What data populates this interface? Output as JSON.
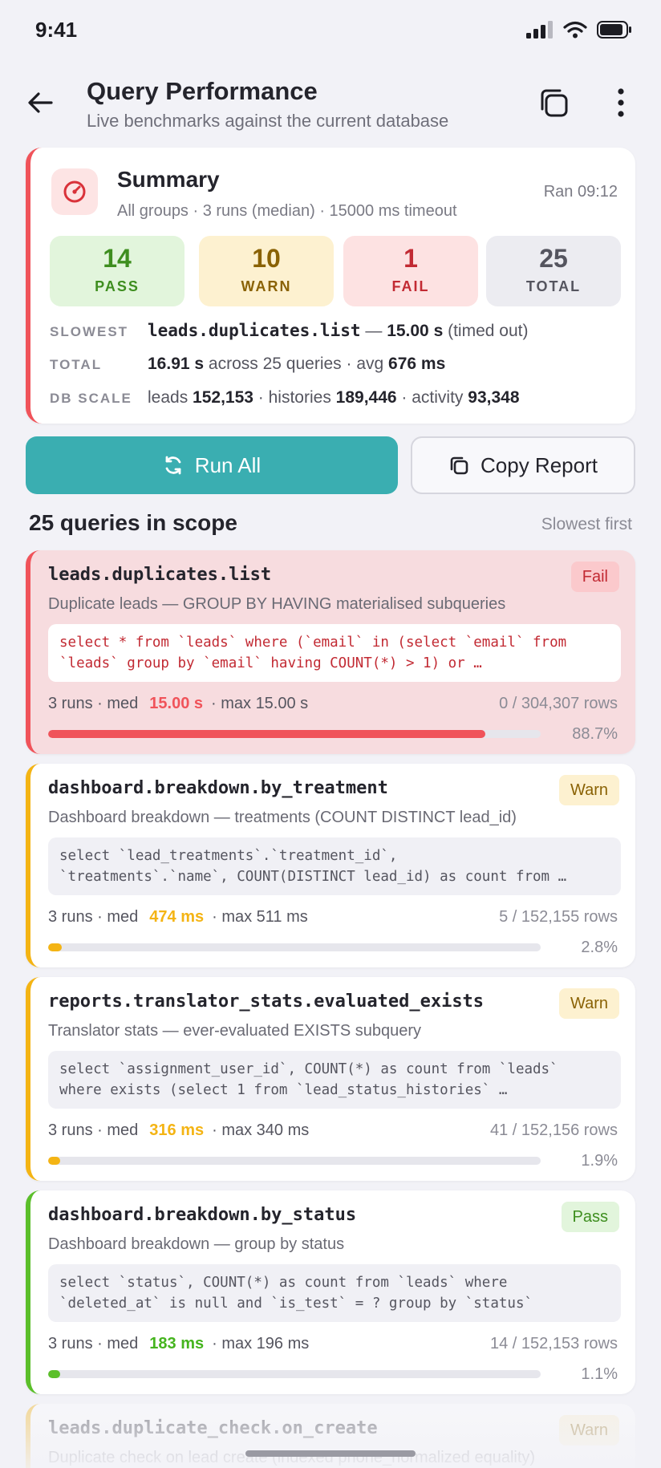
{
  "status_bar": {
    "time": "9:41"
  },
  "header": {
    "title": "Query Performance",
    "subtitle": "Live benchmarks against the current database"
  },
  "summary": {
    "title": "Summary",
    "subtitle": "All groups · 3 runs (median) · 15000 ms timeout",
    "ran": "Ran 09:12",
    "stats": {
      "pass": {
        "value": "14",
        "label": "PASS"
      },
      "warn": {
        "value": "10",
        "label": "WARN"
      },
      "fail": {
        "value": "1",
        "label": "FAIL"
      },
      "total": {
        "value": "25",
        "label": "TOTAL"
      }
    },
    "slowest": {
      "key": "SLOWEST",
      "query": "leads.duplicates.list",
      "sep": " — ",
      "time": "15.00 s",
      "note": " (timed out)"
    },
    "total": {
      "key": "TOTAL",
      "time": "16.91 s",
      "mid": " across 25 queries · avg ",
      "avg": "676 ms"
    },
    "db_scale": {
      "key": "DB SCALE",
      "l1": "leads ",
      "v1": "152,153",
      "l2": " · histories ",
      "v2": "189,446",
      "l3": " · activity ",
      "v3": "93,348"
    }
  },
  "actions": {
    "run_all": "Run All",
    "copy_report": "Copy Report"
  },
  "scope": {
    "title": "25 queries in scope",
    "sort": "Slowest first"
  },
  "stats_prefix": "3 runs · med",
  "max_prefix": "· max",
  "queries": [
    {
      "name": "leads.duplicates.list",
      "status": "Fail",
      "desc": "Duplicate leads — GROUP BY HAVING materialised subqueries",
      "sql1": "select * from `leads` where (`email` in (select `email` from",
      "sql2": "`leads` group by `email` having COUNT(*) > 1) or …",
      "med": "15.00 s",
      "max": "15.00 s",
      "rows": "0 / 304,307 rows",
      "pct": "88.7%",
      "fraction": 0.887
    },
    {
      "name": "dashboard.breakdown.by_treatment",
      "status": "Warn",
      "desc": "Dashboard breakdown — treatments (COUNT DISTINCT lead_id)",
      "sql1": "select `lead_treatments`.`treatment_id`,",
      "sql2": "`treatments`.`name`, COUNT(DISTINCT lead_id) as count from …",
      "med": "474 ms",
      "max": "511 ms",
      "rows": "5 / 152,155 rows",
      "pct": "2.8%",
      "fraction": 0.028
    },
    {
      "name": "reports.translator_stats.evaluated_exists",
      "status": "Warn",
      "desc": "Translator stats — ever-evaluated EXISTS subquery",
      "sql1": "select `assignment_user_id`, COUNT(*) as count from `leads`",
      "sql2": "where exists (select 1 from `lead_status_histories` …",
      "med": "316 ms",
      "max": "340 ms",
      "rows": "41 / 152,156 rows",
      "pct": "1.9%",
      "fraction": 0.019
    },
    {
      "name": "dashboard.breakdown.by_status",
      "status": "Pass",
      "desc": "Dashboard breakdown — group by status",
      "sql1": "select `status`, COUNT(*) as count from `leads` where",
      "sql2": "`deleted_at` is null and `is_test` = ? group by `status`",
      "med": "183 ms",
      "max": "196 ms",
      "rows": "14 / 152,153 rows",
      "pct": "1.1%",
      "fraction": 0.011
    },
    {
      "name": "leads.duplicate_check.on_create",
      "status": "Warn",
      "desc": "Duplicate check on lead create (indexed phone_normalized equality)"
    }
  ],
  "colors": {
    "accent": "#3aaeb1",
    "fail": "#f0535a",
    "warn": "#f4b414",
    "pass": "#5bbf2a"
  },
  "icons": {
    "back": "arrow-left-icon",
    "copy": "copy-icon",
    "more": "more-vertical-icon",
    "summary": "gauge-icon",
    "run": "refresh-icon",
    "report": "copy-icon",
    "signal": "signal-icon",
    "wifi": "wifi-icon",
    "battery": "battery-icon"
  }
}
